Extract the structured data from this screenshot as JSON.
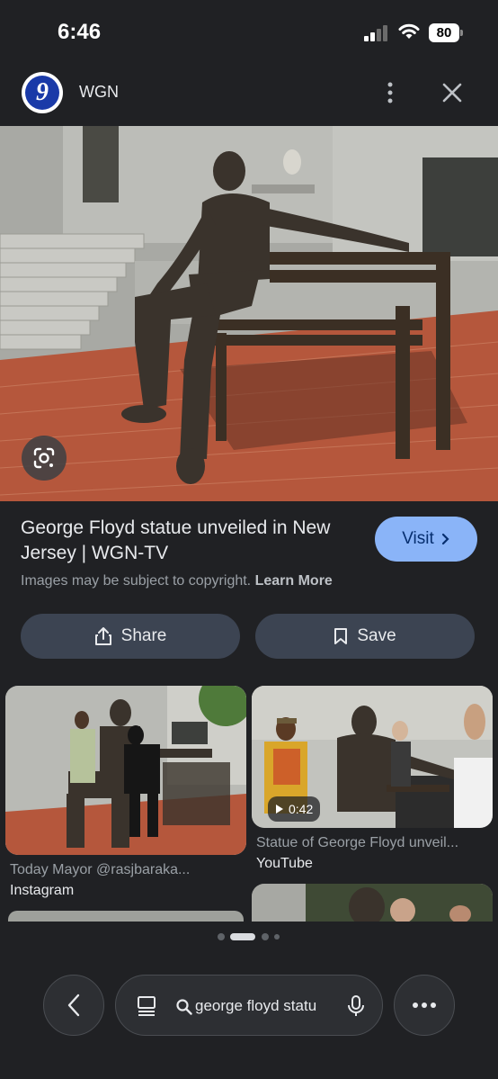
{
  "status_bar": {
    "time": "6:46",
    "battery": "80"
  },
  "header": {
    "site_name": "WGN",
    "logo_text": "9"
  },
  "result": {
    "title": "George Floyd statue unveiled in New Jersey | WGN-TV",
    "visit_label": "Visit",
    "copyright_text": "Images may be subject to copyright.",
    "learn_more_label": "Learn More"
  },
  "actions": {
    "share_label": "Share",
    "save_label": "Save"
  },
  "related": [
    {
      "caption": "Today Mayor @rasjbaraka...",
      "source": "Instagram"
    },
    {
      "caption": "Statue of George Floyd unveil...",
      "source": "YouTube",
      "duration": "0:42"
    }
  ],
  "pagination": {
    "active_index": 1,
    "count": 4
  },
  "bottom_bar": {
    "search_query": "george floyd statu"
  },
  "colors": {
    "background": "#202124",
    "accent": "#8ab4f8",
    "button_bg": "#3c4452"
  }
}
